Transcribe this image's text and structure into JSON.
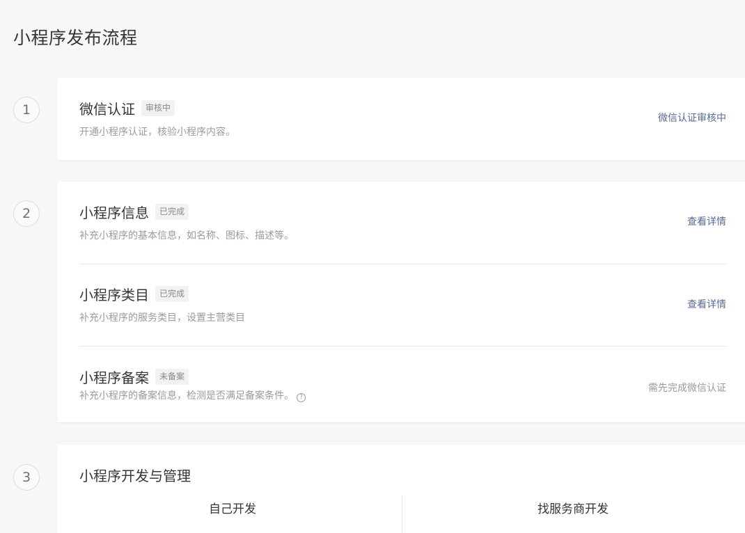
{
  "page": {
    "title": "小程序发布流程"
  },
  "steps": [
    {
      "number": "1",
      "rows": [
        {
          "title": "微信认证",
          "tag": "审核中",
          "desc": "开通小程序认证，核验小程序内容。",
          "action": "微信认证审核中"
        }
      ]
    },
    {
      "number": "2",
      "rows": [
        {
          "title": "小程序信息",
          "tag": "已完成",
          "desc": "补充小程序的基本信息，如名称、图标、描述等。",
          "action": "查看详情"
        },
        {
          "title": "小程序类目",
          "tag": "已完成",
          "desc": "补充小程序的服务类目，设置主营类目",
          "action": "查看详情"
        },
        {
          "title": "小程序备案",
          "tag": "未备案",
          "desc": "补充小程序的备案信息，检测是否满足备案条件。",
          "help_icon": "?",
          "action": "需先完成微信认证"
        }
      ]
    },
    {
      "number": "3",
      "title": "小程序开发与管理",
      "options": [
        "自己开发",
        "找服务商开发"
      ]
    }
  ],
  "colors": {
    "link": "#576b95",
    "muted": "#9a9a9a",
    "background": "#f6f7f9"
  },
  "icons": {
    "help": "question-circle-icon"
  }
}
